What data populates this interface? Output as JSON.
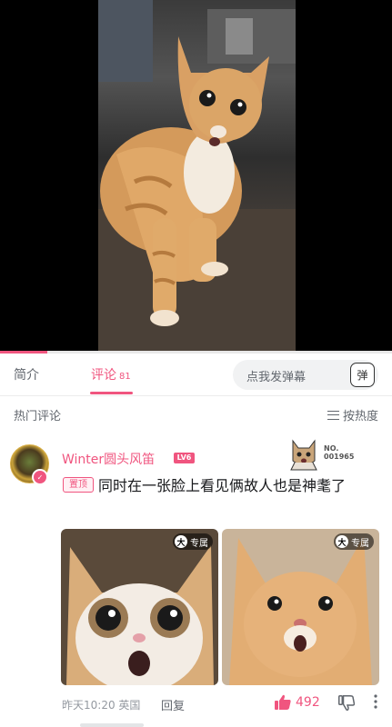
{
  "video": {
    "progress_pct": 12
  },
  "tabs": {
    "intro": "简介",
    "comments": "评论",
    "comments_count": "81"
  },
  "danmaku": {
    "placeholder": "点我发弹幕",
    "button_label": "弹"
  },
  "comments_header": {
    "title": "热门评论",
    "sort_label": "按热度"
  },
  "comment": {
    "username": "Winter圆头风笛",
    "level": "LV6",
    "fan_badge_label": "NO.",
    "fan_badge_number": "001965",
    "pinned_tag": "置顶",
    "text": "同时在一张脸上看见俩故人也是神耄了",
    "images": [
      {
        "tag_icon": "大",
        "tag_label": "专属"
      },
      {
        "tag_icon": "大",
        "tag_label": "专属"
      }
    ],
    "time_location": "昨天10:20 英国",
    "reply_label": "回复",
    "likes": "492"
  },
  "colors": {
    "accent": "#f0557f",
    "text_secondary": "#61666d",
    "meta": "#9499a0"
  }
}
